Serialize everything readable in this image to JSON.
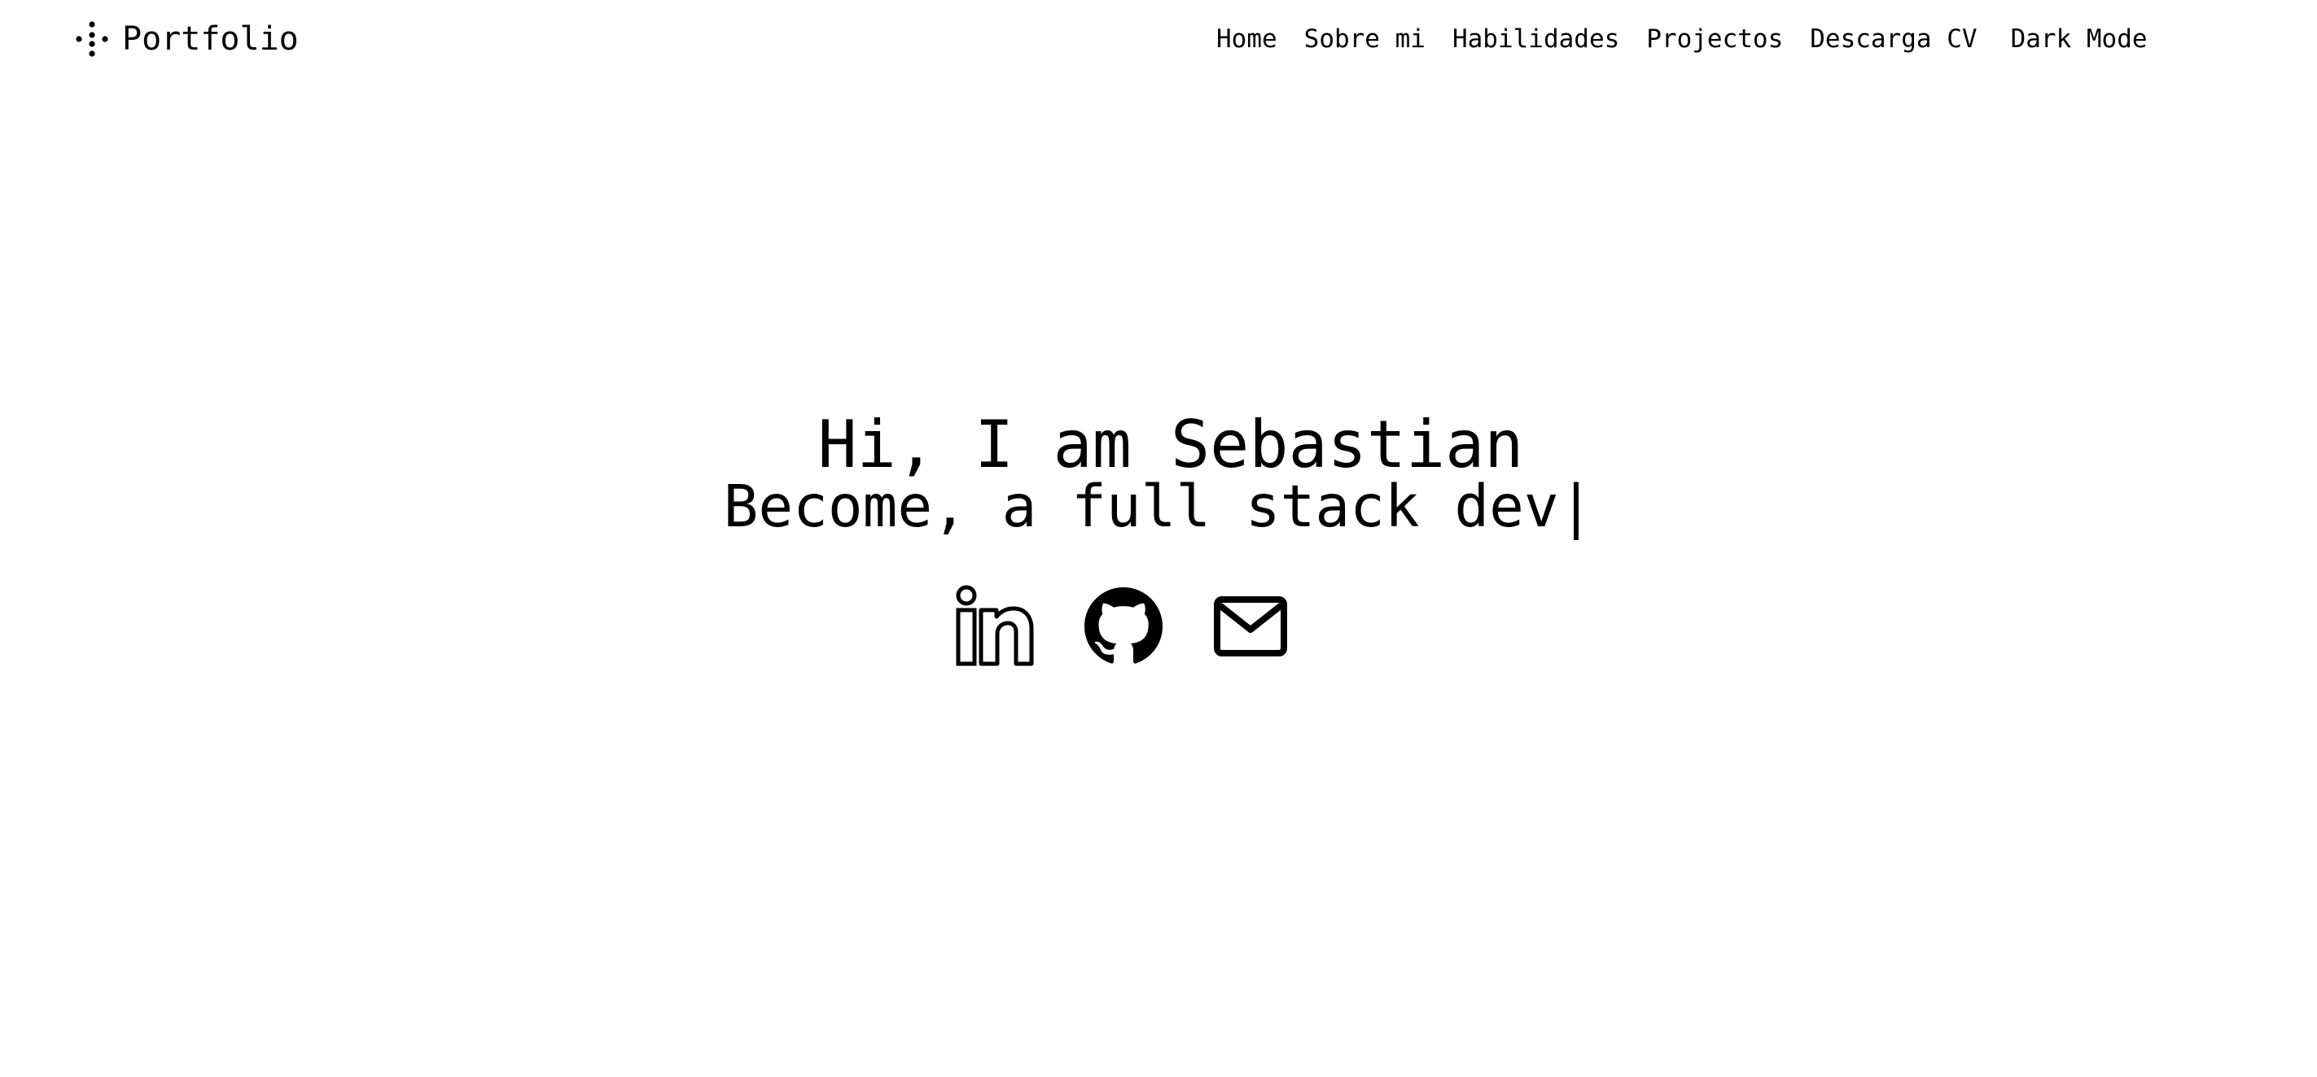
{
  "header": {
    "brand_label": "Portfolio",
    "brand_icon": "dots-icon",
    "nav": [
      {
        "label": "Home"
      },
      {
        "label": "Sobre mi"
      },
      {
        "label": "Habilidades"
      },
      {
        "label": "Projectos"
      },
      {
        "label": "Descarga CV"
      },
      {
        "label": "Dark Mode"
      }
    ]
  },
  "hero": {
    "title": "Hi, I am Sebastian",
    "subtitle": "Become, a full stack dev|"
  },
  "socials": [
    {
      "icon": "linkedin-icon"
    },
    {
      "icon": "github-icon"
    },
    {
      "icon": "mail-icon"
    }
  ],
  "colors": {
    "background": "#ffffff",
    "text": "#000000"
  }
}
